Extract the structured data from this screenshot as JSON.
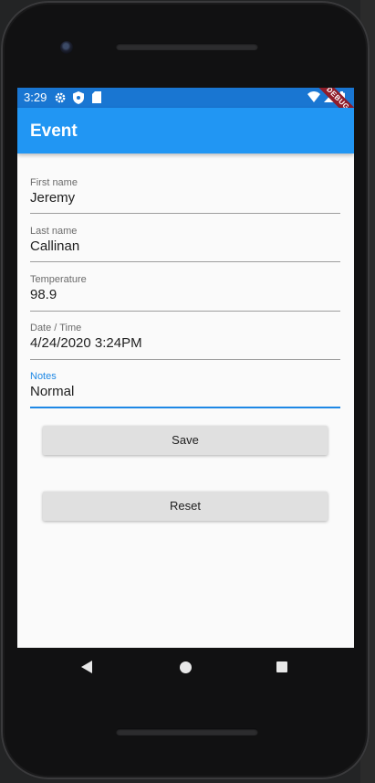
{
  "status": {
    "time": "3:29",
    "debug_label": "DEBUG"
  },
  "appbar": {
    "title": "Event"
  },
  "form": {
    "fields": [
      {
        "label": "First name",
        "value": "Jeremy"
      },
      {
        "label": "Last name",
        "value": "Callinan"
      },
      {
        "label": "Temperature",
        "value": "98.9"
      },
      {
        "label": "Date / Time",
        "value": "4/24/2020 3:24PM"
      },
      {
        "label": "Notes",
        "value": "Normal"
      }
    ],
    "save_label": "Save",
    "reset_label": "Reset"
  },
  "colors": {
    "appbar": "#2196f3",
    "statusbar": "#1976d2",
    "focus": "#1e88e5",
    "button": "#e0e0e0"
  },
  "icons": [
    "settings-icon",
    "shield-icon",
    "sd-card-icon",
    "wifi-icon",
    "signal-icon",
    "battery-icon",
    "back-icon",
    "home-icon",
    "recents-icon"
  ]
}
